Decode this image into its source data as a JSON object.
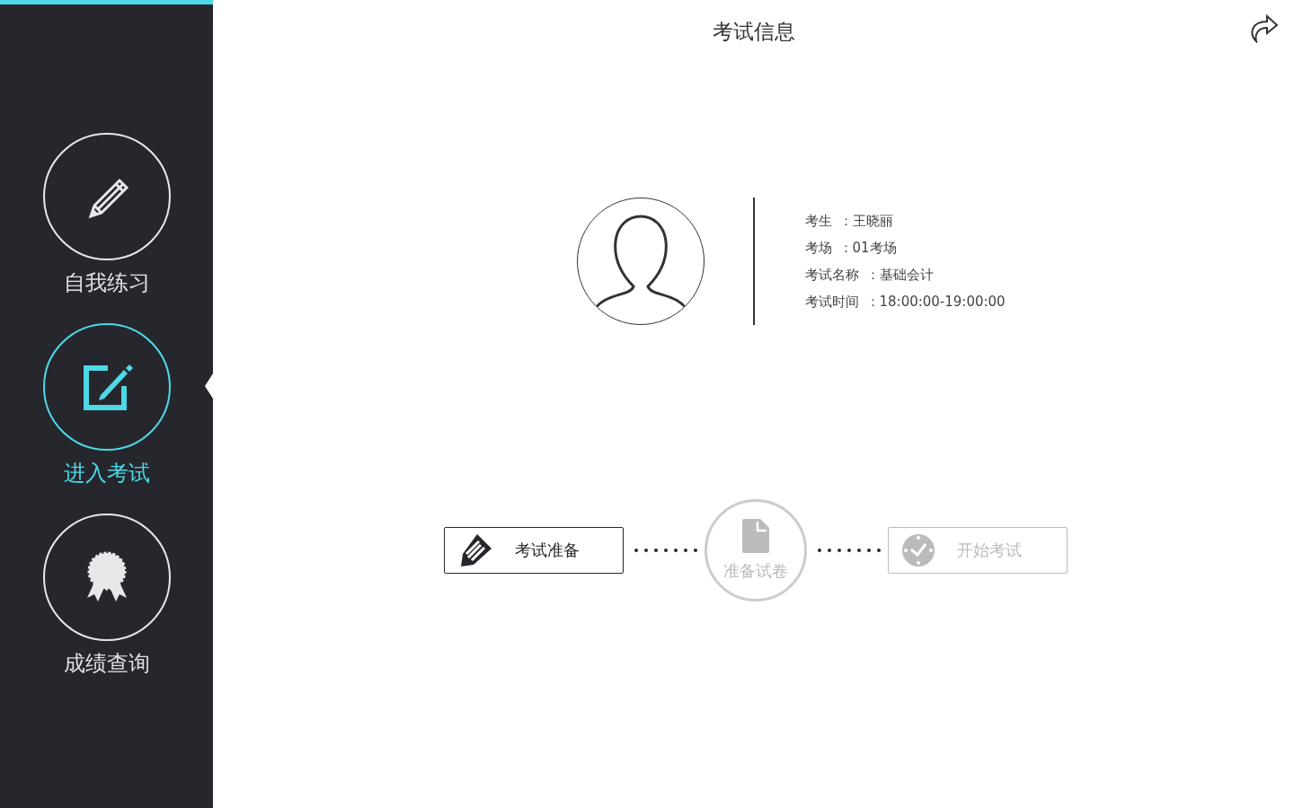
{
  "header": {
    "title": "考试信息"
  },
  "nav": [
    {
      "label": "自我练习",
      "kind": "pencil",
      "selected": false
    },
    {
      "label": "进入考试",
      "kind": "edit",
      "selected": true
    },
    {
      "label": "成绩查询",
      "kind": "award",
      "selected": false
    }
  ],
  "candidate": {
    "fields": [
      {
        "label": "考生",
        "value": "：王晓丽"
      },
      {
        "label": "考场",
        "value": "：01考场"
      },
      {
        "label": "考试名称",
        "value": "：基础会计"
      },
      {
        "label": "考试时间",
        "value": "：18:00:00-19:00:00"
      }
    ]
  },
  "steps": [
    {
      "label": "考试准备",
      "kind": "box",
      "active": true
    },
    {
      "label": "准备试卷",
      "kind": "circle",
      "active": false
    },
    {
      "label": "开始考试",
      "kind": "box",
      "active": false
    }
  ]
}
